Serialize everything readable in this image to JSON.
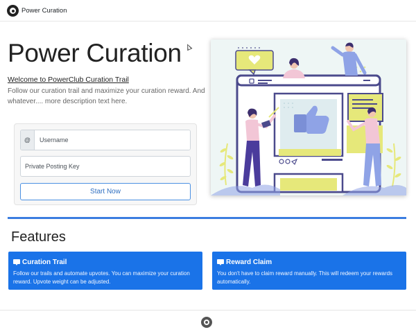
{
  "navbar": {
    "brand_text": "Power Curation",
    "logo_icon": "power-logo-icon"
  },
  "hero": {
    "title": "Power Curation",
    "welcome_link": "Welcome to PowerClub Curation Trail",
    "description": "Follow our curation trail and maximize your curation reward. And whatever.... more description text here."
  },
  "login": {
    "username_prefix": "@",
    "username_placeholder": "Username",
    "key_placeholder": "Private Posting Key",
    "start_button": "Start Now"
  },
  "illustration": {
    "name": "social-media-like-illustration"
  },
  "features": {
    "title": "Features",
    "items": [
      {
        "icon": "comment-icon",
        "title": "Curation Trail",
        "body": "Follow our trails and automate upvotes. You can maximize your curation reward. Upvote weight can be adjusted."
      },
      {
        "icon": "comment-icon",
        "title": "Reward Claim",
        "body": "You don't have to claim reward manually. This will redeem your rewards automatically."
      }
    ]
  },
  "colors": {
    "accent": "#1a73e8",
    "rule": "#3b7de0",
    "button_border": "#4a90e2"
  }
}
